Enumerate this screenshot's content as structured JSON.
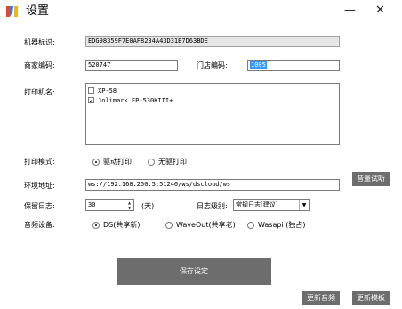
{
  "window": {
    "title": "设置",
    "minimize_glyph": "—",
    "close_glyph": "✕",
    "logo_color_left": "#e8442f",
    "logo_color_mid": "#2f7be8",
    "logo_color_right": "#f2b21a"
  },
  "form": {
    "machine_id_label": "机器标识:",
    "machine_id_value": "EDG98359F7E0AF8234A43D31B7D63BDE",
    "merchant_code_label": "商家编码:",
    "merchant_code_value": "520747",
    "store_code_label": "门店编码:",
    "store_code_value": "1005",
    "printer_label": "打印机名:",
    "printers": [
      {
        "name": "XP-58",
        "checked": false,
        "check_glyph": ""
      },
      {
        "name": "Jolimark FP-530KIII+",
        "checked": true,
        "check_glyph": "✓"
      }
    ],
    "print_mode_label": "打印模式:",
    "print_mode_options": [
      "驱动打印",
      "无驱打印"
    ],
    "print_mode_selected": "驱动打印",
    "env_url_label": "环境地址:",
    "env_url_value": "ws://192.168.250.5:51240/ws/dscloud/ws",
    "volume_test_button": "音量试听",
    "log_keep_label": "保留日志:",
    "log_keep_value": "30",
    "log_keep_unit": "(天)",
    "log_level_label": "日志级别:",
    "log_level_value": "常规日志[建议]",
    "audio_device_label": "音频设备:",
    "audio_devices": [
      "DS(共享新)",
      "WaveOut(共享老)",
      "Wasapi (独占)"
    ],
    "audio_device_selected": "DS(共享新)"
  },
  "buttons": {
    "save": "保存设定",
    "update_audio": "更新音频",
    "update_template": "更新模板"
  }
}
